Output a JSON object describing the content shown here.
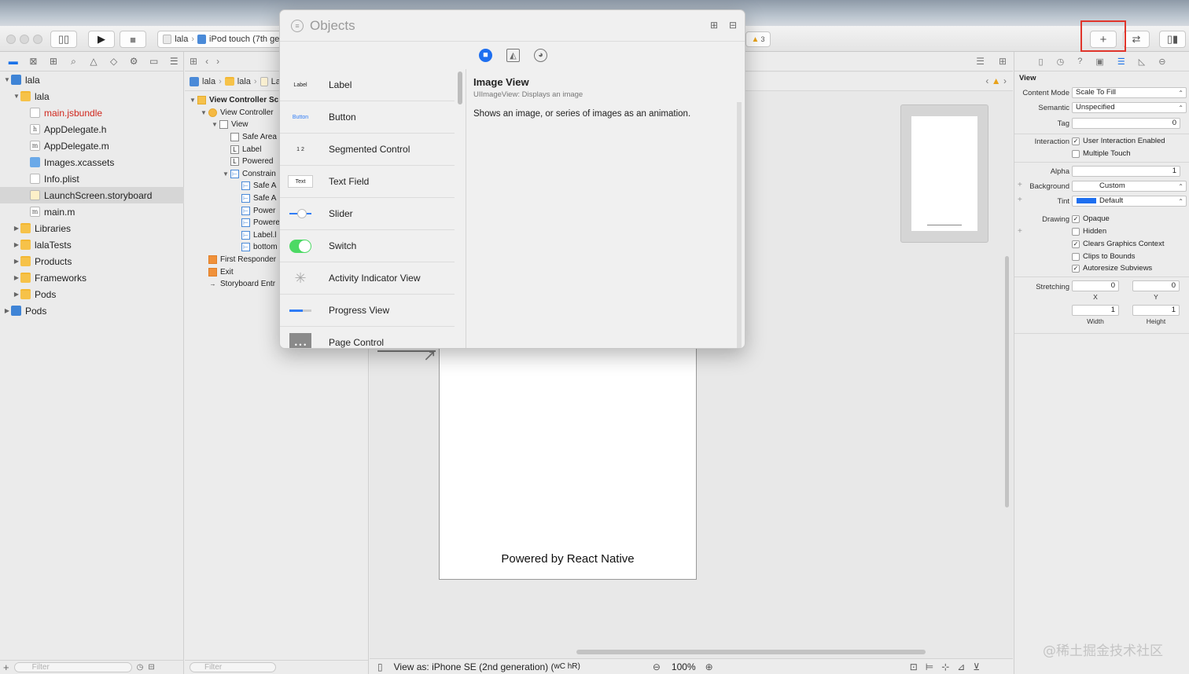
{
  "toolbar": {
    "scheme_project": "lala",
    "scheme_device": "iPod touch (7th ger",
    "warning_count": "3",
    "add_icon": "plus-icon",
    "accent_highlight": "#e0352b"
  },
  "navigator": {
    "items": [
      {
        "label": "lala",
        "type": "project",
        "expanded": true
      },
      {
        "label": "lala",
        "type": "folder",
        "expanded": true
      },
      {
        "label": "main.jsbundle",
        "type": "file-missing"
      },
      {
        "label": "AppDelegate.h",
        "type": "file-h"
      },
      {
        "label": "AppDelegate.m",
        "type": "file-m"
      },
      {
        "label": "Images.xcassets",
        "type": "xcassets"
      },
      {
        "label": "Info.plist",
        "type": "plist"
      },
      {
        "label": "LaunchScreen.storyboard",
        "type": "storyboard",
        "selected": true
      },
      {
        "label": "main.m",
        "type": "file-m"
      },
      {
        "label": "Libraries",
        "type": "folder"
      },
      {
        "label": "lalaTests",
        "type": "folder"
      },
      {
        "label": "Products",
        "type": "folder"
      },
      {
        "label": "Frameworks",
        "type": "folder"
      },
      {
        "label": "Pods",
        "type": "folder"
      },
      {
        "label": "Pods",
        "type": "project"
      }
    ],
    "filter_placeholder": "Filter"
  },
  "outline": {
    "jump": [
      "lala",
      "lala",
      "La"
    ],
    "rows": [
      {
        "label": "View Controller Sc",
        "indent": 0,
        "bold": true,
        "icon": "scene"
      },
      {
        "label": "View Controller",
        "indent": 1,
        "icon": "vc"
      },
      {
        "label": "View",
        "indent": 2,
        "icon": "view"
      },
      {
        "label": "Safe Area",
        "indent": 3,
        "icon": "view"
      },
      {
        "label": "Label",
        "indent": 3,
        "icon": "L"
      },
      {
        "label": "Powered",
        "indent": 3,
        "icon": "L"
      },
      {
        "label": "Constrain",
        "indent": 3,
        "icon": "blue"
      },
      {
        "label": "Safe A",
        "indent": 4,
        "icon": "blue"
      },
      {
        "label": "Safe A",
        "indent": 4,
        "icon": "blue"
      },
      {
        "label": "Power",
        "indent": 4,
        "icon": "blue"
      },
      {
        "label": "Powere",
        "indent": 4,
        "icon": "blue"
      },
      {
        "label": "Label.l",
        "indent": 4,
        "icon": "blue"
      },
      {
        "label": "bottom",
        "indent": 4,
        "icon": "blue"
      },
      {
        "label": "First Responder",
        "indent": 1,
        "icon": "orange"
      },
      {
        "label": "Exit",
        "indent": 1,
        "icon": "orange"
      },
      {
        "label": "Storyboard Entr",
        "indent": 1,
        "icon": "arrow"
      }
    ],
    "filter_placeholder": "Filter"
  },
  "canvas": {
    "device_text": "Powered by React Native",
    "view_as": "View as: iPhone SE (2nd generation) (",
    "view_as_suffix": "wC  hR)",
    "zoom": "100%"
  },
  "library": {
    "search_placeholder": "Objects",
    "items": [
      {
        "label": "Label",
        "thumb": "Label"
      },
      {
        "label": "Button",
        "thumb": "Button"
      },
      {
        "label": "Segmented Control",
        "thumb": "1  2"
      },
      {
        "label": "Text Field",
        "thumb": "Text"
      },
      {
        "label": "Slider",
        "thumb": "slider"
      },
      {
        "label": "Switch",
        "thumb": "switch"
      },
      {
        "label": "Activity Indicator View",
        "thumb": "spinner"
      },
      {
        "label": "Progress View",
        "thumb": "progress"
      },
      {
        "label": "Page Control",
        "thumb": "page"
      }
    ],
    "detail_title": "Image View",
    "detail_subtitle": "UIImageView: Displays an image",
    "detail_body": "Shows an image, or series of images as an animation."
  },
  "inspector": {
    "section": "View",
    "content_mode_label": "Content Mode",
    "content_mode": "Scale To Fill",
    "semantic_label": "Semantic",
    "semantic": "Unspecified",
    "tag_label": "Tag",
    "tag": "0",
    "interaction_label": "Interaction",
    "user_interaction": "User Interaction Enabled",
    "multiple_touch": "Multiple Touch",
    "alpha_label": "Alpha",
    "alpha": "1",
    "background_label": "Background",
    "background": "Custom",
    "tint_label": "Tint",
    "tint": "Default",
    "tint_color": "#1e6ff0",
    "drawing_label": "Drawing",
    "opaque": "Opaque",
    "hidden": "Hidden",
    "clears": "Clears Graphics Context",
    "clips": "Clips to Bounds",
    "autoresize": "Autoresize Subviews",
    "stretching_label": "Stretching",
    "stretch_x": "0",
    "stretch_y": "0",
    "stretch_w": "1",
    "stretch_h": "1",
    "x_label": "X",
    "y_label": "Y",
    "width_label": "Width",
    "height_label": "Height"
  },
  "watermark": "@稀土掘金技术社区"
}
